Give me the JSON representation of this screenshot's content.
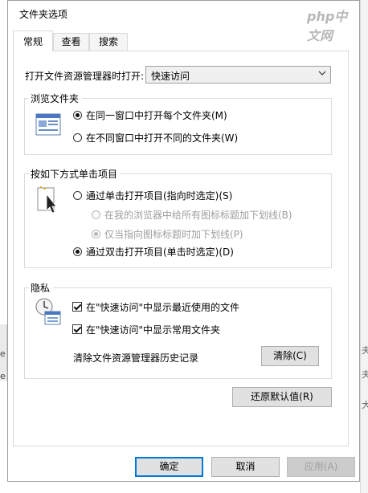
{
  "window": {
    "title": "文件夹选项",
    "watermark": "php中文网"
  },
  "tabs": [
    {
      "label": "常规",
      "active": true
    },
    {
      "label": "查看",
      "active": false
    },
    {
      "label": "搜索",
      "active": false
    }
  ],
  "open_explorer": {
    "label": "打开文件资源管理器时打开:",
    "value": "快速访问"
  },
  "browse_folders": {
    "legend": "浏览文件夹",
    "options": [
      {
        "label": "在同一窗口中打开每个文件夹(M)",
        "checked": true
      },
      {
        "label": "在不同窗口中打开不同的文件夹(W)",
        "checked": false
      }
    ]
  },
  "click_items": {
    "legend": "按如下方式单击项目",
    "single_click": {
      "label": "通过单击打开项目(指向时选定)(S)",
      "checked": false
    },
    "underline_always": {
      "label": "在我的浏览器中给所有图标标题加下划线(B)",
      "checked": false,
      "disabled": true
    },
    "underline_point": {
      "label": "仅当指向图标标题时加下划线(P)",
      "checked": true,
      "disabled": true
    },
    "double_click": {
      "label": "通过双击打开项目(单击时选定)(D)",
      "checked": true
    }
  },
  "privacy": {
    "legend": "隐私",
    "show_recent_files": {
      "label": "在\"快速访问\"中显示最近使用的文件",
      "checked": true
    },
    "show_frequent_folders": {
      "label": "在\"快速访问\"中显示常用文件夹",
      "checked": true
    },
    "clear_history_label": "清除文件资源管理器历史记录",
    "clear_button": "清除(C)"
  },
  "restore_defaults_button": "还原默认值(R)",
  "footer": {
    "ok": "确定",
    "cancel": "取消",
    "apply": "应用(A)"
  },
  "background": {
    "left_chars": [
      "e",
      "e"
    ],
    "right_chars": [
      "夫",
      "夫",
      "大"
    ]
  },
  "colors": {
    "accent": "#0078d7",
    "border": "#d9d9d9",
    "disabled_text": "#9e9e9e"
  }
}
